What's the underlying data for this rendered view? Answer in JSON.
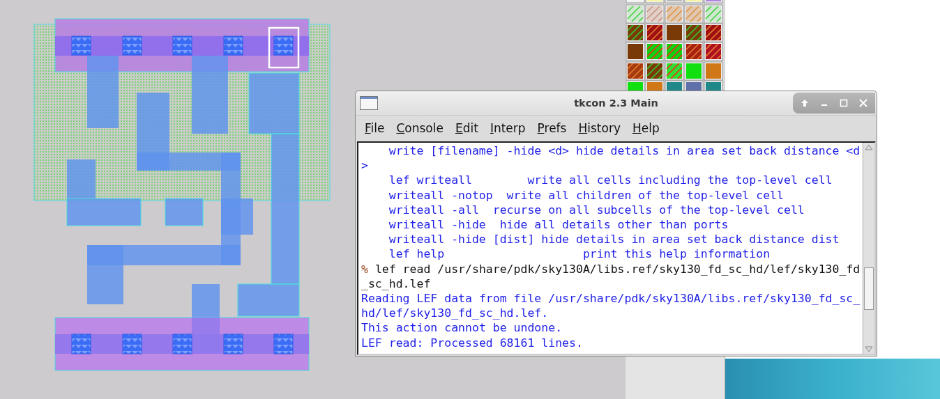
{
  "window": {
    "title": "tkcon 2.3 Main"
  },
  "menu": [
    {
      "label": "File"
    },
    {
      "label": "Console"
    },
    {
      "label": "Edit"
    },
    {
      "label": "Interp"
    },
    {
      "label": "Prefs"
    },
    {
      "label": "History"
    },
    {
      "label": "Help"
    }
  ],
  "console": [
    {
      "kind": "help",
      "text": "write [filename] -hide <d> hide details in area set back distance <d>"
    },
    {
      "kind": "help",
      "text": "lef writeall        write all cells including the top-level cell"
    },
    {
      "kind": "help",
      "text": "writeall -notop  write all children of the top-level cell"
    },
    {
      "kind": "help",
      "text": "writeall -all  recurse on all subcells of the top-level cell"
    },
    {
      "kind": "help",
      "text": "writeall -hide  hide all details other than ports"
    },
    {
      "kind": "help",
      "text": "writeall -hide [dist] hide details in area set back distance dist"
    },
    {
      "kind": "help",
      "text": "lef help                    print this help information"
    },
    {
      "kind": "command",
      "prompt": "%",
      "text": "lef read /usr/share/pdk/sky130A/libs.ref/sky130_fd_sc_hd/lef/sky130_fd_sc_hd.lef"
    },
    {
      "kind": "output",
      "text": "Reading LEF data from file /usr/share/pdk/sky130A/libs.ref/sky130_fd_sc_hd/lef/sky130_fd_sc_hd.lef."
    },
    {
      "kind": "output",
      "text": "This action cannot be undone."
    },
    {
      "kind": "output",
      "text": "LEF read: Processed 68161 lines."
    }
  ]
}
